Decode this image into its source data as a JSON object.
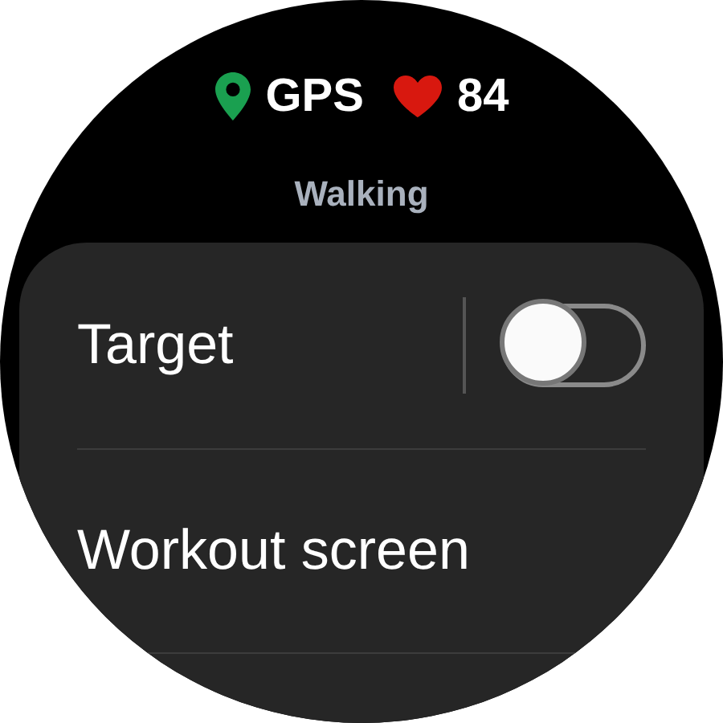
{
  "status_bar": {
    "gps": "GPS",
    "heart_rate": "84"
  },
  "title": "Walking",
  "settings": [
    {
      "kind": "toggle",
      "label": "Target",
      "on": false
    },
    {
      "kind": "link",
      "label": "Workout screen"
    }
  ]
}
